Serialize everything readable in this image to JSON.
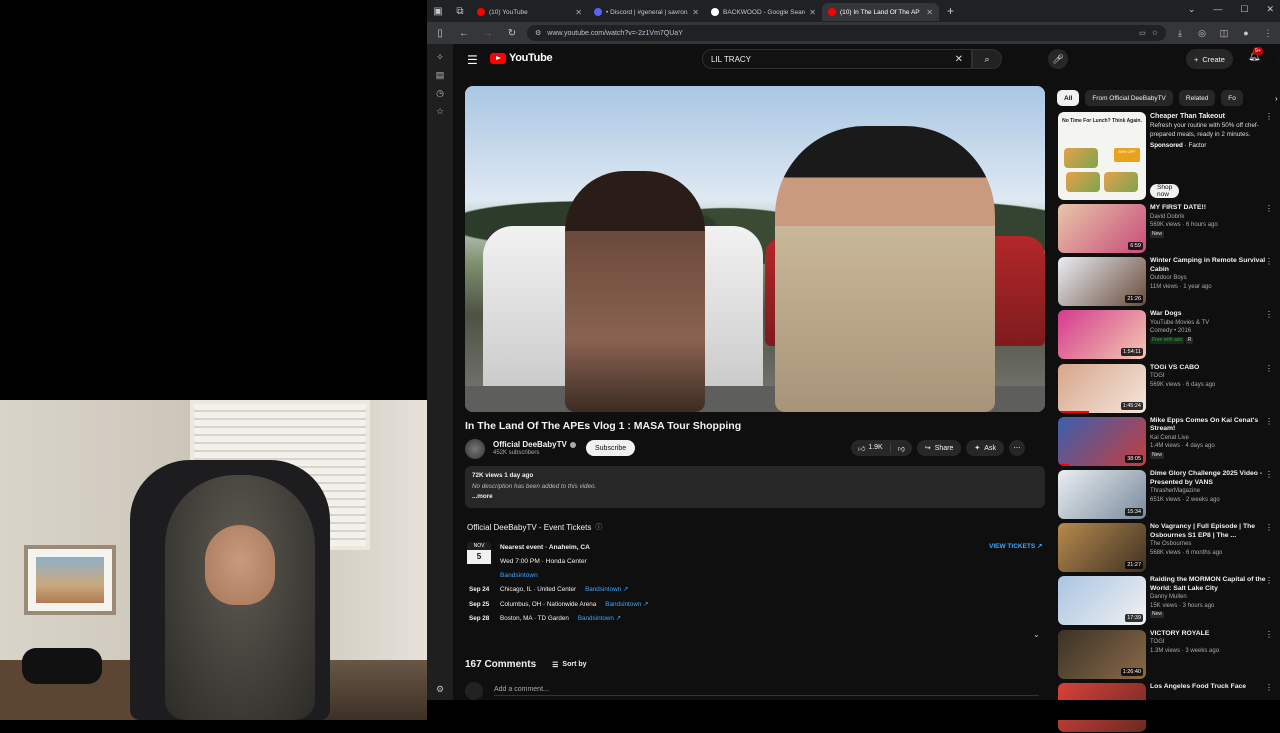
{
  "browser": {
    "tabs": [
      {
        "title": "(10) YouTube",
        "color": "#ff0000",
        "active": false
      },
      {
        "title": "• Discord | #general | savrona's",
        "color": "#5865f2",
        "active": false
      },
      {
        "title": "BACKWOOD - Google Search",
        "color": "#ffffff",
        "active": false
      },
      {
        "title": "(10) In The Land Of The AP",
        "color": "#ff0000",
        "active": true
      }
    ],
    "url": "www.youtube.com/watch?v=-2z1Vm7QUaY"
  },
  "masthead": {
    "logo_text": "YouTube",
    "search_query": "LIL TRACY",
    "create_label": "Create",
    "notification_count": "9+"
  },
  "video": {
    "title": "In The Land Of The APEs Vlog 1 : MASA Tour Shopping",
    "channel": "Official DeeBabyTV",
    "subscribers": "452K subscribers",
    "subscribe_label": "Subscribe",
    "likes": "1.9K",
    "share_label": "Share",
    "ask_label": "Ask",
    "views_date": "72K views  1 day ago",
    "description": "No description has been added to this video.",
    "more_label": "...more"
  },
  "tickets": {
    "heading": "Official DeeBabyTV - Event Tickets",
    "view_tickets_label": "VIEW TICKETS",
    "nearest": {
      "month": "NOV",
      "day": "5",
      "title": "Nearest event · Anaheim, CA",
      "time_venue": "Wed 7:00 PM · Honda Center",
      "seller": "Bandsintown"
    },
    "events": [
      {
        "date": "Sep 24",
        "place": "Chicago, IL · United Center",
        "seller": "Bandsintown"
      },
      {
        "date": "Sep 25",
        "place": "Columbus, OH · Nationwide Arena",
        "seller": "Bandsintown"
      },
      {
        "date": "Sep 28",
        "place": "Boston, MA · TD Garden",
        "seller": "Bandsintown"
      }
    ]
  },
  "comments": {
    "count_label": "167 Comments",
    "sort_label": "Sort by",
    "add_placeholder": "Add a comment..."
  },
  "chips": [
    "All",
    "From Official DeeBabyTV",
    "Related",
    "Fo"
  ],
  "ad": {
    "headline": "No Time For Lunch? Think Again.",
    "offer": "50% OFF",
    "title": "Cheaper Than Takeout",
    "body": "Refresh your routine with 50% off chef-prepared meals, ready in 2 minutes.",
    "sponsored": "Sponsored",
    "advertiser": "· Factor",
    "cta": "Shop now"
  },
  "recommendations": [
    {
      "title": "MY FIRST DATE!!",
      "channel": "David Dobrik",
      "meta": "569K views · 6 hours ago",
      "badge": "New",
      "duration": "6:59",
      "colors": [
        "#e8c6a8",
        "#c94c7a"
      ],
      "progress": 0
    },
    {
      "title": "Winter Camping in Remote Survival Cabin",
      "channel": "Outdoor Boys",
      "meta": "11M views · 1 year ago",
      "badge": "",
      "duration": "21:26",
      "colors": [
        "#e9eef3",
        "#6a4b3c"
      ],
      "progress": 0
    },
    {
      "title": "War Dogs",
      "channel": "YouTube Movies & TV",
      "meta": "Comedy • 2016",
      "badge": "Free with ads",
      "rating": "R",
      "duration": "1:54:11",
      "colors": [
        "#d63a8e",
        "#f2c9b0"
      ],
      "progress": 0
    },
    {
      "title": "TOGi VS CABO",
      "channel": "TOGI",
      "meta": "569K views · 6 days ago",
      "badge": "",
      "duration": "1:45:24",
      "colors": [
        "#d8a58a",
        "#f3e7dd"
      ],
      "progress": 0.35
    },
    {
      "title": "Mike Epps Comes On Kai Cenat's Stream!",
      "channel": "Kai Cenat Live",
      "meta": "1.4M views · 4 days ago",
      "badge": "New",
      "duration": "38:05",
      "colors": [
        "#3a5fb0",
        "#c43e3e"
      ],
      "progress": 0.12
    },
    {
      "title": "Dime Glory Challenge 2025 Video - Presented by VANS",
      "channel": "ThrasherMagazine",
      "meta": "651K views · 2 weeks ago",
      "badge": "",
      "duration": "15:34",
      "colors": [
        "#e9eef2",
        "#7a8a9c"
      ],
      "progress": 0
    },
    {
      "title": "No Vagrancy | Full Episode | The Osbournes S1 EP8 | The ...",
      "channel": "The Osbournes",
      "meta": "568K views · 6 months ago",
      "badge": "",
      "duration": "21:27",
      "colors": [
        "#b8894e",
        "#3e3322"
      ],
      "progress": 0
    },
    {
      "title": "Raiding the MORMON Capital of the World: Salt Lake City",
      "channel": "Danny Mullen",
      "meta": "15K views · 3 hours ago",
      "badge": "New",
      "duration": "17:39",
      "colors": [
        "#a9c4e2",
        "#f2f2f2"
      ],
      "progress": 0
    },
    {
      "title": "VICTORY ROYALE",
      "channel": "TOGI",
      "meta": "1.3M views · 3 weeks ago",
      "badge": "",
      "duration": "1:26:40",
      "colors": [
        "#3a3226",
        "#8b6a48"
      ],
      "progress": 0
    },
    {
      "title": "Los Angeles Food Truck Face",
      "channel": "",
      "meta": "",
      "badge": "",
      "duration": "",
      "colors": [
        "#d9413a",
        "#6a2a22"
      ],
      "progress": 0
    }
  ]
}
